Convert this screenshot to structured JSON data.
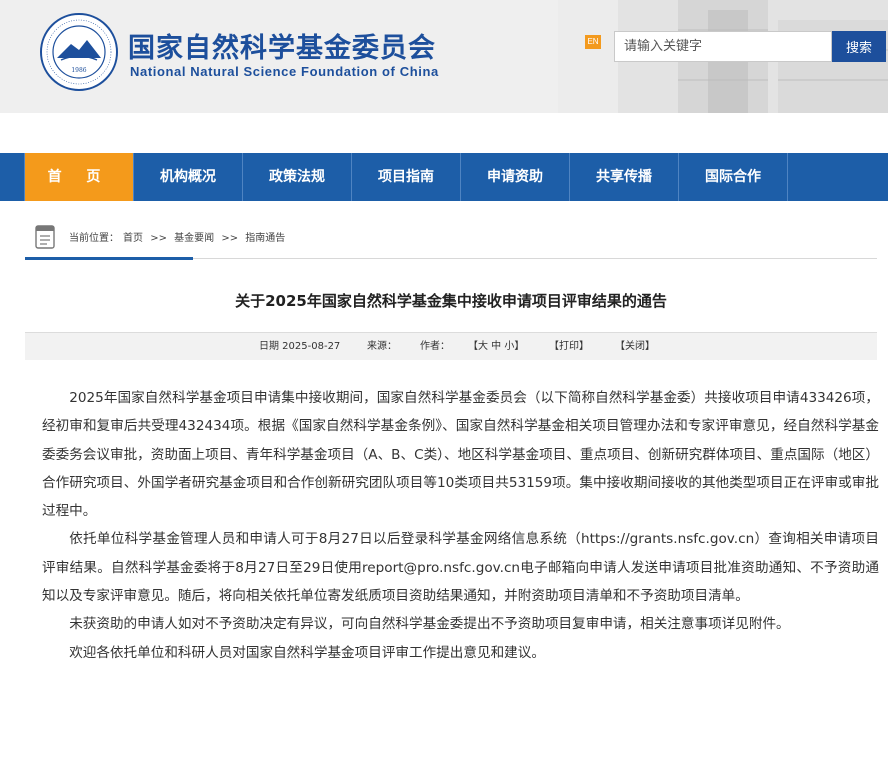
{
  "header": {
    "title_cn": "国家自然科学基金委员会",
    "title_en": "National Natural Science Foundation of China",
    "logo_year": "1986",
    "en_label": "EN",
    "search_placeholder": "请输入关键字",
    "search_button": "搜索"
  },
  "nav": {
    "items": [
      "首 页",
      "机构概况",
      "政策法规",
      "项目指南",
      "申请资助",
      "共享传播",
      "国际合作"
    ]
  },
  "breadcrumb": {
    "prefix": "当前位置：",
    "home": "首页",
    "sep": ">>",
    "level1": "基金要闻",
    "level2": "指南通告"
  },
  "article": {
    "title": "关于2025年国家自然科学基金集中接收申请项目评审结果的通告",
    "meta": {
      "date": "日期 2025-08-27",
      "source": "来源：",
      "author": "作者：",
      "size": "【大 中 小】",
      "print": "【打印】",
      "close": "【关闭】"
    },
    "paragraphs": [
      "2025年国家自然科学基金项目申请集中接收期间，国家自然科学基金委员会（以下简称自然科学基金委）共接收项目申请433426项，经初审和复审后共受理432434项。根据《国家自然科学基金条例》、国家自然科学基金相关项目管理办法和专家评审意见，经自然科学基金委委务会议审批，资助面上项目、青年科学基金项目（A、B、C类）、地区科学基金项目、重点项目、创新研究群体项目、重点国际（地区）合作研究项目、外国学者研究基金项目和合作创新研究团队项目等10类项目共53159项。集中接收期间接收的其他类型项目正在评审或审批过程中。",
      "依托单位科学基金管理人员和申请人可于8月27日以后登录科学基金网络信息系统（https://grants.nsfc.gov.cn）查询相关申请项目评审结果。自然科学基金委将于8月27日至29日使用report@pro.nsfc.gov.cn电子邮箱向申请人发送申请项目批准资助通知、不予资助通知以及专家评审意见。随后，将向相关依托单位寄发纸质项目资助结果通知，并附资助项目清单和不予资助项目清单。",
      "未获资助的申请人如对不予资助决定有异议，可向自然科学基金委提出不予资助项目复审申请，相关注意事项详见附件。",
      "欢迎各依托单位和科研人员对国家自然科学基金项目评审工作提出意见和建议。"
    ]
  },
  "colors": {
    "brand_blue": "#1d4f9c",
    "nav_blue": "#1d5ea8",
    "accent_orange": "#f49a1b"
  }
}
